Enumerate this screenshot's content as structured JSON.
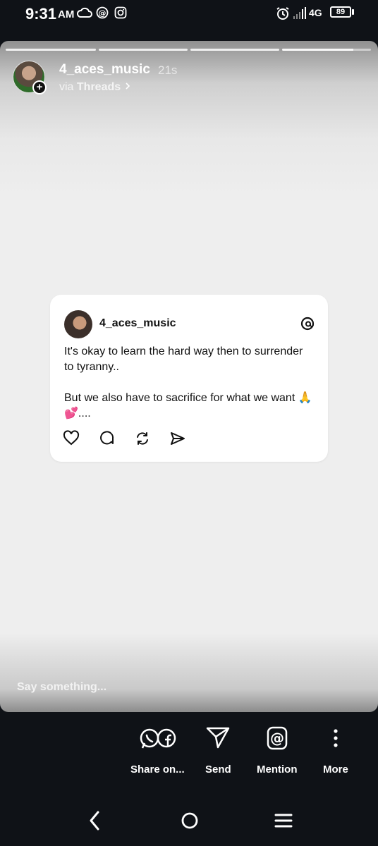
{
  "status_bar": {
    "time": "9:31",
    "ampm": "AM",
    "network": "4G",
    "battery": "89"
  },
  "story": {
    "username": "4_aces_music",
    "time_ago": "21s",
    "via_prefix": "via",
    "via_app": "Threads",
    "progress_segments": 4,
    "reply_placeholder": "Say something..."
  },
  "post": {
    "username": "4_aces_music",
    "text": "It's okay to learn the hard way then to surrender to tyranny..\n\nBut we also have to sacrifice for what we want 🙏💕...."
  },
  "share_bar": {
    "items": [
      {
        "label": "Share on..."
      },
      {
        "label": "Send"
      },
      {
        "label": "Mention"
      },
      {
        "label": "More"
      }
    ]
  },
  "colors": {
    "background": "#0f1217",
    "story_bg": "#eeeeee",
    "card_bg": "#ffffff"
  }
}
